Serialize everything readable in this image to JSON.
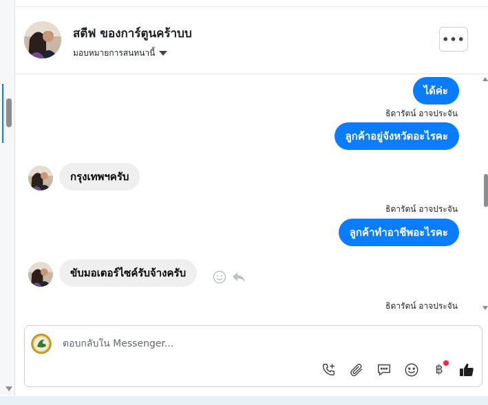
{
  "header": {
    "contact_name": "สตีฟ ของการ์ตูนคร้าบบ",
    "assign_label": "มอบหมายการสนทนานี้",
    "more_label": "•••"
  },
  "messages": [
    {
      "type": "outgoing",
      "text": "ได้ค่ะ"
    },
    {
      "type": "outgoing",
      "sender": "ธิดารัตน์ อาจประจัน",
      "text": "ลูกค้าอยู่จังหวัดอะไรคะ"
    },
    {
      "type": "incoming",
      "text": "กรุงเทพฯครับ"
    },
    {
      "type": "outgoing",
      "sender": "ธิดารัตน์ อาจประจัน",
      "text": "ลูกค้าทำอาชีพอะไรคะ"
    },
    {
      "type": "incoming",
      "text": "ขับมอเตอร์ไซค์รับจ้างครับ"
    },
    {
      "type": "outgoing",
      "sender": "ธิดารัตน์ อาจประจัน",
      "text": ""
    }
  ],
  "composer": {
    "placeholder": "ตอบกลับใน Messenger...",
    "currency_symbol": "฿"
  },
  "colors": {
    "outgoing_bubble": "#0a7cff",
    "incoming_bubble": "#efefef",
    "notification_dot": "#f02849"
  },
  "icons": [
    "more-icon",
    "chevron-down-icon",
    "react-icon",
    "reply-icon",
    "call-add-icon",
    "attachment-icon",
    "saved-replies-icon",
    "emoji-icon",
    "baht-icon",
    "like-icon"
  ]
}
